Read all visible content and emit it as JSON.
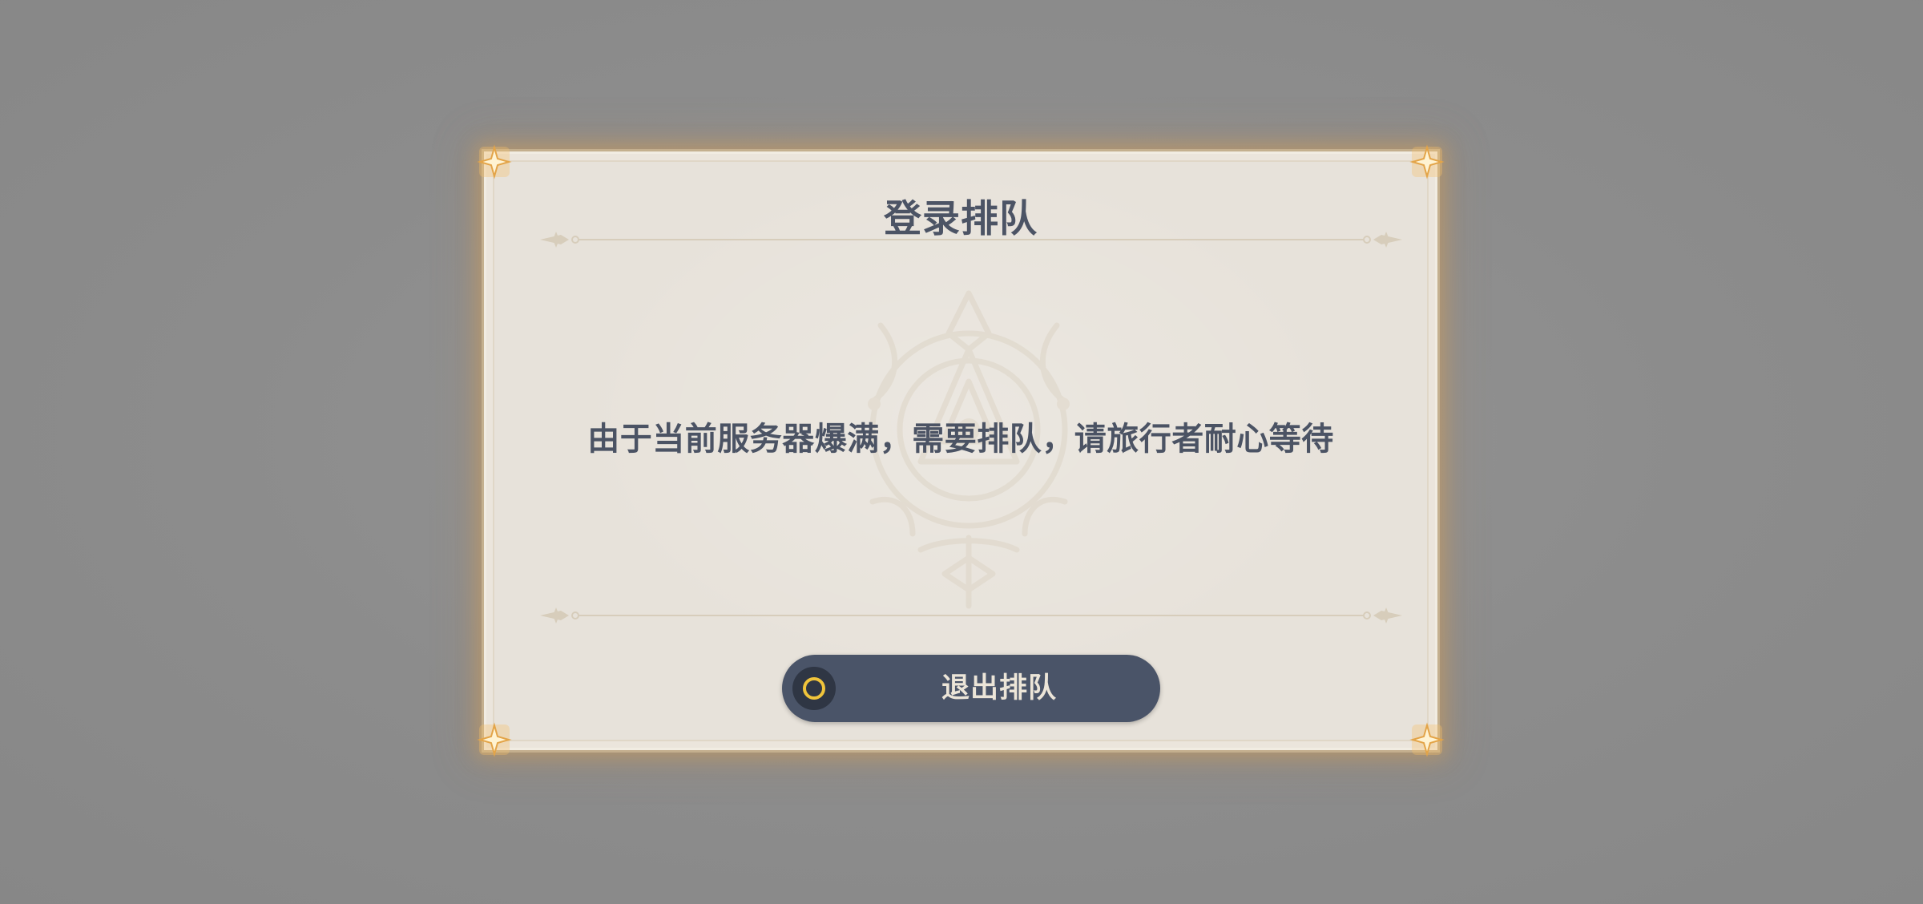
{
  "dialog": {
    "title": "登录排队",
    "message": "由于当前服务器爆满，需要排队，请旅行者耐心等待",
    "exit_button": {
      "label": "退出排队",
      "icon": "circle-confirm-icon",
      "icon_ring_color": "#f0c43b"
    }
  },
  "colors": {
    "backdrop": "#8b8b8b",
    "dialog_background": "#e7e2da",
    "text": "#4b5364",
    "button_background": "#4a5468",
    "button_text": "#ece5d8",
    "corner_glow": "#f6c06b"
  },
  "decorations": {
    "emblem": "faded-crest-watermark-icon",
    "corners": "gold-star-corner-icon",
    "dividers": "ornamental-divider-icon"
  }
}
